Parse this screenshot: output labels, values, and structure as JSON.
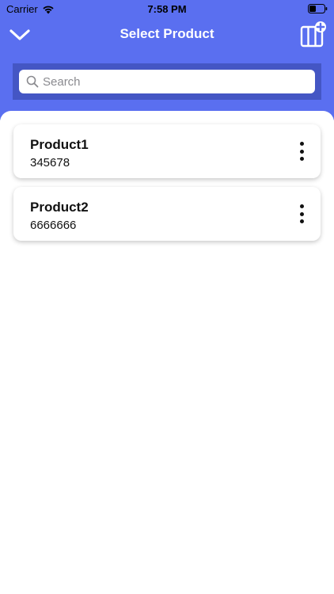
{
  "status_bar": {
    "carrier": "Carrier",
    "time": "7:58 PM"
  },
  "nav": {
    "title": "Select Product",
    "back_icon": "chevron-down-icon",
    "action_icon": "add-product-icon"
  },
  "search": {
    "placeholder": "Search",
    "value": ""
  },
  "products": [
    {
      "name": "Product1",
      "code": "345678"
    },
    {
      "name": "Product2",
      "code": "6666666"
    }
  ],
  "colors": {
    "header": "#5a6ff0",
    "search_bar": "#4456c4",
    "text": "#111111"
  }
}
